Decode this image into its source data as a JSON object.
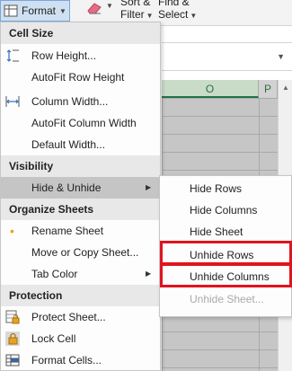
{
  "ribbon": {
    "format_label": "Format",
    "sort_filter_label": "Sort &\nFilter",
    "sort_line1": "Sort &",
    "sort_line2": "Filter",
    "find_line1": "Find &",
    "find_line2": "Select"
  },
  "columns": [
    "O",
    "P"
  ],
  "menu": {
    "cell_size": {
      "header": "Cell Size",
      "row_height": "Row Height...",
      "autofit_row_height": "AutoFit Row Height",
      "column_width": "Column Width...",
      "autofit_column_width": "AutoFit Column Width",
      "default_width": "Default Width..."
    },
    "visibility": {
      "header": "Visibility",
      "hide_unhide": "Hide & Unhide"
    },
    "organize": {
      "header": "Organize Sheets",
      "rename_sheet": "Rename Sheet",
      "move_copy_sheet": "Move or Copy Sheet...",
      "tab_color": "Tab Color"
    },
    "protection": {
      "header": "Protection",
      "protect_sheet": "Protect Sheet...",
      "lock_cell": "Lock Cell",
      "format_cells": "Format Cells..."
    }
  },
  "submenu": {
    "hide_rows": "Hide Rows",
    "hide_columns": "Hide Columns",
    "hide_sheet": "Hide Sheet",
    "unhide_rows": "Unhide Rows",
    "unhide_columns": "Unhide Columns",
    "unhide_sheet": "Unhide Sheet..."
  },
  "colors": {
    "highlight_box": "#e0141e",
    "column_header_text": "#2f6f3f"
  }
}
